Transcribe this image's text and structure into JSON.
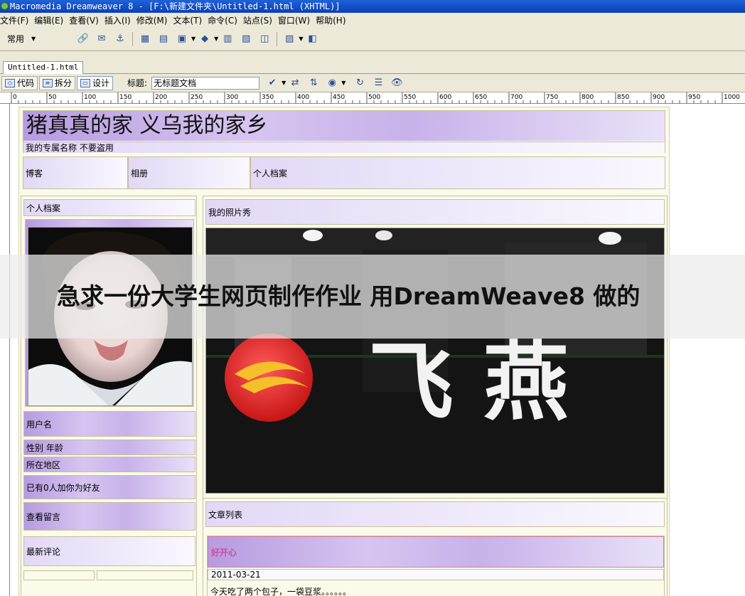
{
  "window": {
    "title": "Macromedia Dreamweaver 8 - [F:\\新建文件夹\\Untitled-1.html (XHTML)]"
  },
  "menu": [
    "文件(F)",
    "编辑(E)",
    "查看(V)",
    "插入(I)",
    "修改(M)",
    "文本(T)",
    "命令(C)",
    "站点(S)",
    "窗口(W)",
    "帮助(H)"
  ],
  "insert_toolbar": {
    "category": "常用",
    "icons": [
      "hyperlink-icon",
      "email-link-icon",
      "named-anchor-icon",
      "table-icon",
      "layer-icon",
      "image-icon",
      "media-icon",
      "date-icon",
      "comment-icon",
      "template-icon",
      "tag-chooser-icon"
    ]
  },
  "document": {
    "tab": "Untitled-1.html",
    "views": [
      "代码",
      "拆分",
      "设计"
    ],
    "active_view": "设计",
    "title_label": "标题:",
    "title_value": "无标题文档"
  },
  "ruler": {
    "labels": [
      "0",
      "50",
      "100",
      "150",
      "200",
      "250",
      "300",
      "350",
      "400",
      "450",
      "500",
      "550",
      "600",
      "650",
      "700",
      "750",
      "800",
      "850",
      "900",
      "950",
      "1000"
    ]
  },
  "site": {
    "title": "猪真真的家  义乌我的家乡",
    "subtitle": "我的专属名称 不要盗用",
    "nav": [
      "博客",
      "相册",
      "个人档案"
    ],
    "left": {
      "header": "个人档案",
      "username": "用户名",
      "gender_age": "性别 年龄",
      "location": "所在地区",
      "friends": "已有0人加你为好友",
      "messages": "查看留言",
      "comments": "最新评论"
    },
    "right": {
      "photo_header": "我的照片秀",
      "sign_text": "飞  燕",
      "articles_header": "文章列表",
      "article_title": "好开心",
      "article_date": "2011-03-21",
      "article_body": "今天吃了两个包子，一袋豆浆。。。。。。"
    }
  },
  "overlay": {
    "caption": "急求一份大学生网页制作作业 用DreamWeave8 做的"
  }
}
